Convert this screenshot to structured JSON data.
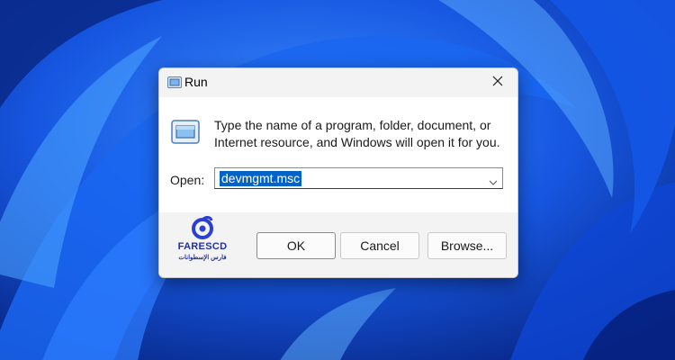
{
  "window": {
    "title": "Run",
    "title_icon": "run-icon",
    "close_icon": "close-icon"
  },
  "content": {
    "icon": "run-icon",
    "description_line1": "Type the name of a program, folder, document, or",
    "description_line2": "Internet resource, and Windows will open it for you.",
    "open_label": "Open:",
    "open_value": "devmgmt.msc",
    "dropdown_icon": "chevron-down-icon"
  },
  "buttons": {
    "ok": "OK",
    "cancel": "Cancel",
    "browse": "Browse..."
  },
  "watermark": {
    "name": "FARESCD",
    "subtitle": "فارس الإسطوانات"
  },
  "colors": {
    "accent": "#0063c8",
    "wallpaper": "#0a2a8c"
  }
}
